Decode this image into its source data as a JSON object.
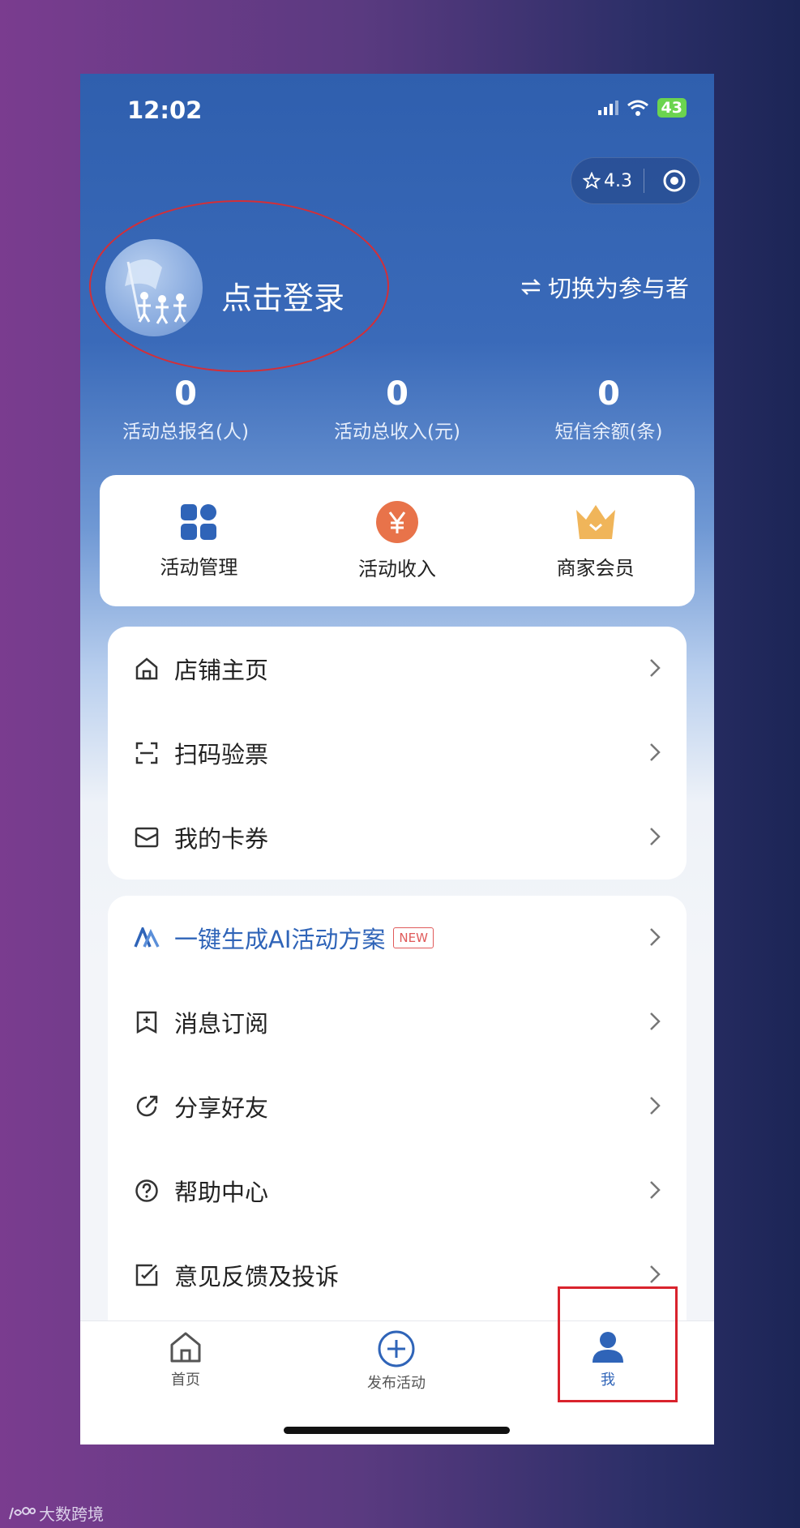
{
  "status_bar": {
    "time": "12:02",
    "battery": "43"
  },
  "capsule": {
    "rating": "4.3"
  },
  "profile": {
    "login_label": "点击登录",
    "switch_role": "切换为参与者"
  },
  "stats": [
    {
      "value": "0",
      "label": "活动总报名(人)"
    },
    {
      "value": "0",
      "label": "活动总收入(元)"
    },
    {
      "value": "0",
      "label": "短信余额(条)"
    }
  ],
  "quick_actions": [
    {
      "label": "活动管理",
      "icon": "grid-icon"
    },
    {
      "label": "活动收入",
      "icon": "yuan-icon"
    },
    {
      "label": "商家会员",
      "icon": "crown-icon"
    }
  ],
  "menu_group_1": [
    {
      "label": "店铺主页",
      "icon": "store-home-icon"
    },
    {
      "label": "扫码验票",
      "icon": "scan-icon"
    },
    {
      "label": "我的卡券",
      "icon": "coupon-icon"
    }
  ],
  "menu_group_2": [
    {
      "label": "一键生成AI活动方案",
      "icon": "ai-logo-icon",
      "badge": "NEW"
    },
    {
      "label": "消息订阅",
      "icon": "subscribe-icon"
    },
    {
      "label": "分享好友",
      "icon": "share-icon"
    },
    {
      "label": "帮助中心",
      "icon": "help-icon"
    },
    {
      "label": "意见反馈及投诉",
      "icon": "feedback-icon"
    }
  ],
  "tabbar": [
    {
      "label": "首页",
      "icon": "home-icon",
      "active": false
    },
    {
      "label": "发布活动",
      "icon": "plus-circle-icon",
      "active": false
    },
    {
      "label": "我",
      "icon": "user-icon",
      "active": true
    }
  ],
  "watermark": "大数跨境",
  "colors": {
    "accent": "#2f64b8",
    "highlight": "#d9232d",
    "yuan": "#e8734a",
    "crown": "#f0b55a"
  }
}
